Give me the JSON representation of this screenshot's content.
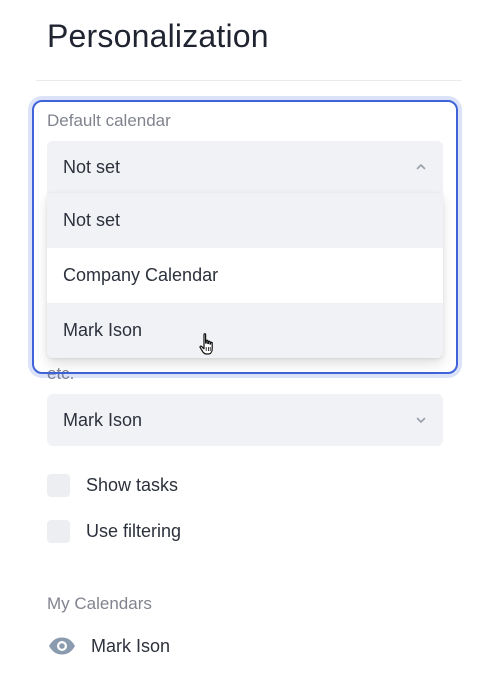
{
  "panel": {
    "title": "Personalization"
  },
  "default_calendar": {
    "label": "Default calendar",
    "selected": "Not set",
    "options": [
      "Not set",
      "Company Calendar",
      "Mark Ison"
    ]
  },
  "second_field": {
    "label_fragment": "etc.",
    "selected": "Mark Ison"
  },
  "checkboxes": {
    "show_tasks": {
      "label": "Show tasks",
      "checked": false
    },
    "use_filtering": {
      "label": "Use filtering",
      "checked": false
    }
  },
  "my_calendars": {
    "label": "My Calendars",
    "items": [
      {
        "name": "Mark Ison",
        "icon": "eye-icon",
        "visible": true
      }
    ]
  },
  "colors": {
    "focus_ring": "#3f63d8",
    "field_bg": "#f1f2f5",
    "muted_text": "#80848e"
  }
}
